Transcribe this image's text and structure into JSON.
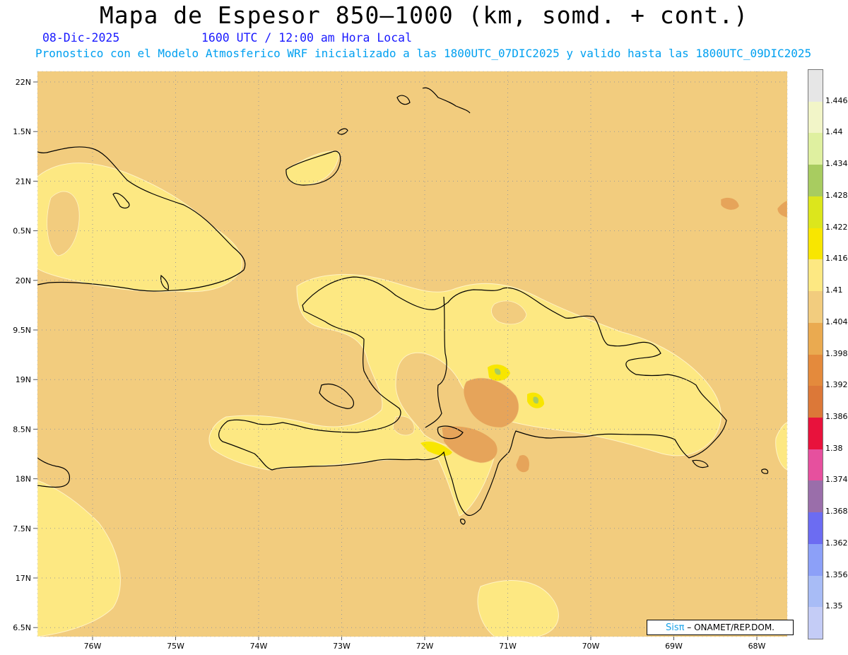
{
  "header": {
    "title": "Mapa de Espesor 850—1000 (km, somd. + cont.)",
    "date": "08-Dic-2025",
    "time": "1600 UTC / 12:00 am Hora Local",
    "description": "Pronostico con el Modelo Atmosferico WRF inicializado a las 1800UTC_07DIC2025 y valido hasta las  1800UTC_09DIC2025"
  },
  "map": {
    "base_color": "#f2cc7e",
    "coast_color": "#000000",
    "grid_color": "#999999",
    "lat_labels": [
      "22N",
      "1.5N",
      "21N",
      "0.5N",
      "20N",
      "9.5N",
      "19N",
      "8.5N",
      "18N",
      "7.5N",
      "17N",
      "6.5N"
    ],
    "lon_labels": [
      "76W",
      "75W",
      "74W",
      "73W",
      "72W",
      "71W",
      "70W",
      "69W",
      "68W"
    ]
  },
  "credit": {
    "brand": "Sisπ",
    "text": "– ONAMET/REP.DOM."
  },
  "legend": {
    "labels": [
      "1.446",
      "1.44",
      "1.434",
      "1.428",
      "1.422",
      "1.416",
      "1.41",
      "1.404",
      "1.398",
      "1.392",
      "1.386",
      "1.38",
      "1.374",
      "1.368",
      "1.362",
      "1.356",
      "1.35"
    ],
    "colors": [
      "#e6e6e6",
      "#f2f5c8",
      "#dff0a0",
      "#a8cc60",
      "#dce61c",
      "#f8e600",
      "#fde882",
      "#f2cc7e",
      "#eaaa50",
      "#e48a3c",
      "#dc7838",
      "#e8123c",
      "#e6509e",
      "#9a6eaa",
      "#6c6cf2",
      "#8ca0f8",
      "#a8bcf6",
      "#c4ccf6"
    ]
  }
}
